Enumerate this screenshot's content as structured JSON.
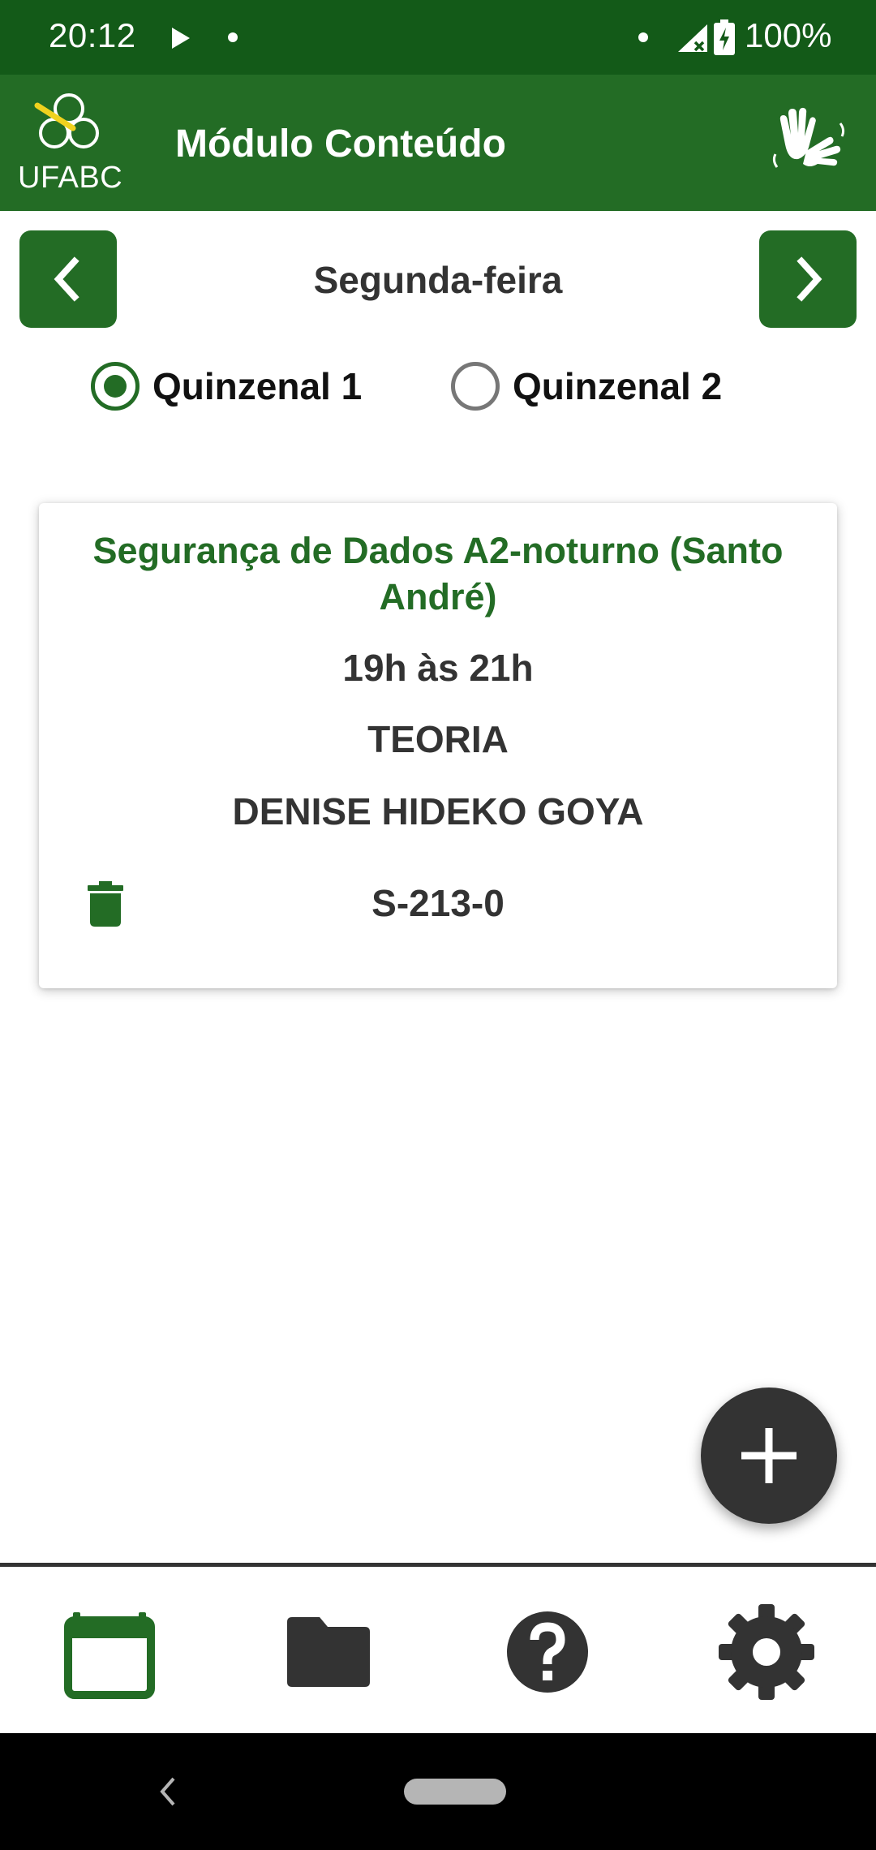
{
  "status_bar": {
    "time": "20:12",
    "battery": "100%",
    "icons": [
      "play-icon",
      "notification-dot",
      "notification-dot",
      "signal-no-data-icon",
      "battery-charging-icon"
    ]
  },
  "app_bar": {
    "logo_text": "UFABC",
    "title": "Módulo Conteúdo",
    "action_icon": "sign-language-icon"
  },
  "day_selector": {
    "day": "Segunda-feira",
    "prev_icon": "chevron-left-icon",
    "next_icon": "chevron-right-icon"
  },
  "fortnight": {
    "options": [
      {
        "label": "Quinzenal 1",
        "checked": true
      },
      {
        "label": "Quinzenal 2",
        "checked": false
      }
    ]
  },
  "classes": [
    {
      "name": "Segurança de Dados A2-noturno (Santo André)",
      "time": "19h às 21h",
      "type": "TEORIA",
      "professor": "DENISE HIDEKO GOYA",
      "room": "S-213-0",
      "delete_icon": "trash-icon"
    }
  ],
  "fab": {
    "icon": "plus-icon"
  },
  "bottom_nav": {
    "items": [
      {
        "icon": "calendar-icon",
        "active": true
      },
      {
        "icon": "folder-icon",
        "active": false
      },
      {
        "icon": "help-icon",
        "active": false
      },
      {
        "icon": "settings-icon",
        "active": false
      }
    ]
  },
  "colors": {
    "status_bar": "#135a18",
    "primary": "#236c25",
    "dark": "#333333",
    "text": "#333333"
  }
}
